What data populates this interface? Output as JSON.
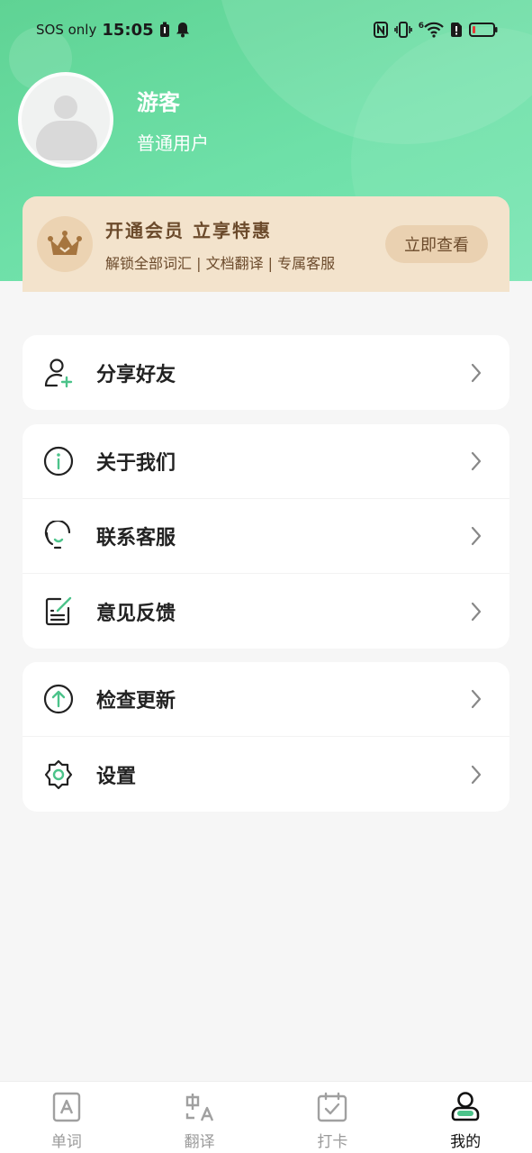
{
  "status_bar": {
    "carrier": "SOS only",
    "time": "15:05",
    "network_label": "6"
  },
  "profile": {
    "name": "游客",
    "role": "普通用户"
  },
  "vip": {
    "title": "开通会员 立享特惠",
    "subtitle": "解锁全部词汇 | 文档翻译 | 专属客服",
    "button": "立即查看"
  },
  "menu": {
    "group1": [
      {
        "label": "分享好友",
        "icon": "add-user-icon"
      }
    ],
    "group2": [
      {
        "label": "关于我们",
        "icon": "info-icon"
      },
      {
        "label": "联系客服",
        "icon": "headset-icon"
      },
      {
        "label": "意见反馈",
        "icon": "feedback-icon"
      }
    ],
    "group3": [
      {
        "label": "检查更新",
        "icon": "upload-icon"
      },
      {
        "label": "设置",
        "icon": "gear-icon"
      }
    ]
  },
  "tabbar": [
    {
      "label": "单词",
      "icon": "word-card-icon",
      "active": false
    },
    {
      "label": "翻译",
      "icon": "translate-icon",
      "active": false
    },
    {
      "label": "打卡",
      "icon": "calendar-check-icon",
      "active": false
    },
    {
      "label": "我的",
      "icon": "profile-icon",
      "active": true
    }
  ],
  "colors": {
    "accent": "#4cc38a",
    "header_green": "#66da9e",
    "vip_bg": "#f3e3cc",
    "vip_text": "#6b4a2b"
  }
}
